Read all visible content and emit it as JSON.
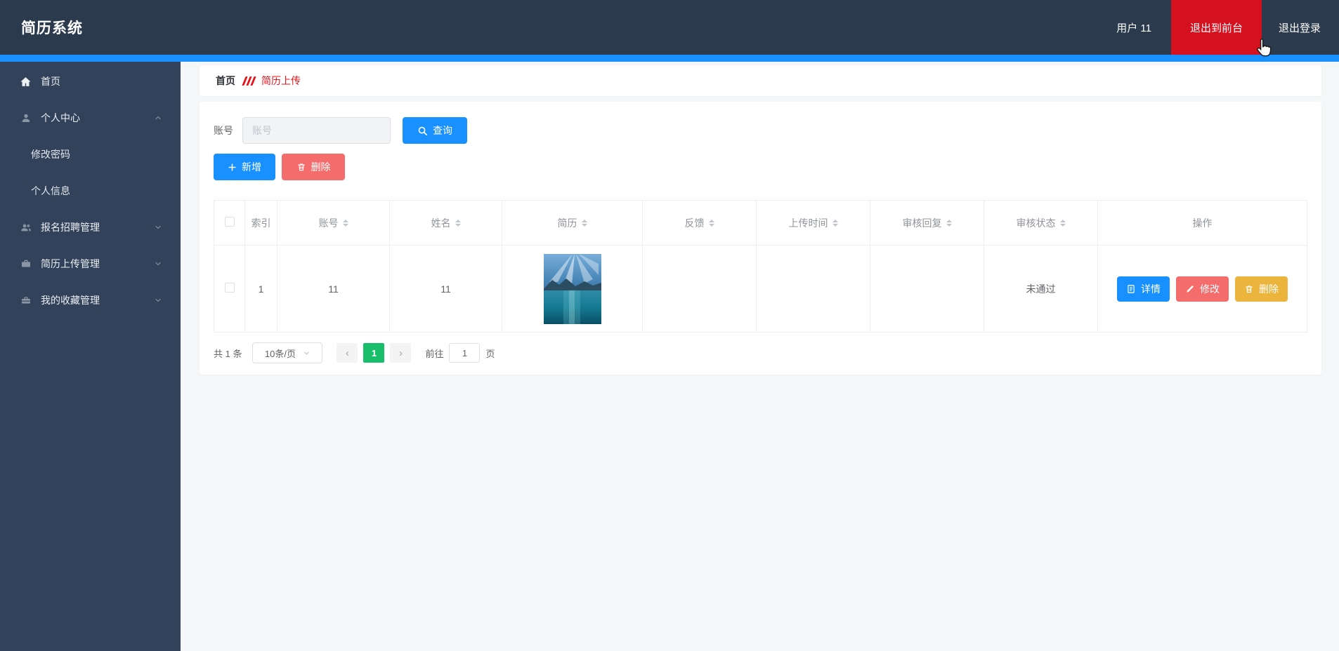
{
  "app": {
    "title": "简历系统"
  },
  "navbar": {
    "user": "用户 11",
    "exit_front": "退出到前台",
    "logout": "退出登录"
  },
  "sidebar": {
    "items": [
      {
        "label": "首页",
        "icon": "home-icon"
      },
      {
        "label": "个人中心",
        "icon": "user-icon",
        "expanded": true,
        "children": [
          {
            "label": "修改密码"
          },
          {
            "label": "个人信息"
          }
        ]
      },
      {
        "label": "报名招聘管理",
        "icon": "users-icon"
      },
      {
        "label": "简历上传管理",
        "icon": "briefcase-icon"
      },
      {
        "label": "我的收藏管理",
        "icon": "toolbox-icon"
      }
    ]
  },
  "breadcrumb": {
    "home": "首页",
    "current": "简历上传"
  },
  "search": {
    "label": "账号",
    "placeholder": "账号",
    "value": "",
    "button": "查询"
  },
  "toolbar": {
    "add": "新增",
    "delete": "删除"
  },
  "table": {
    "columns": [
      "索引",
      "账号",
      "姓名",
      "简历",
      "反馈",
      "上传时间",
      "审核回复",
      "审核状态",
      "操作"
    ],
    "row": {
      "index": "1",
      "account": "11",
      "name": "11",
      "resume_image": "lake-mountain-photo",
      "feedback": "",
      "upload_time": "",
      "review_reply": "",
      "review_status": "未通过"
    },
    "row_actions": {
      "detail": "详情",
      "edit": "修改",
      "delete": "删除"
    }
  },
  "pagination": {
    "total": "共 1 条",
    "page_size": "10条/页",
    "prev": "‹",
    "page": "1",
    "next": "›",
    "goto_label": "前往",
    "goto_value": "1",
    "unit": "页"
  },
  "colors": {
    "accent_blue": "#1890ff",
    "nav_red": "#d6111f",
    "danger_red": "#f56c6c",
    "warning_amber": "#ebb43d",
    "active_green": "#19be6b",
    "header_dark": "#2c3a4d",
    "sidebar_dark": "#31425a"
  }
}
